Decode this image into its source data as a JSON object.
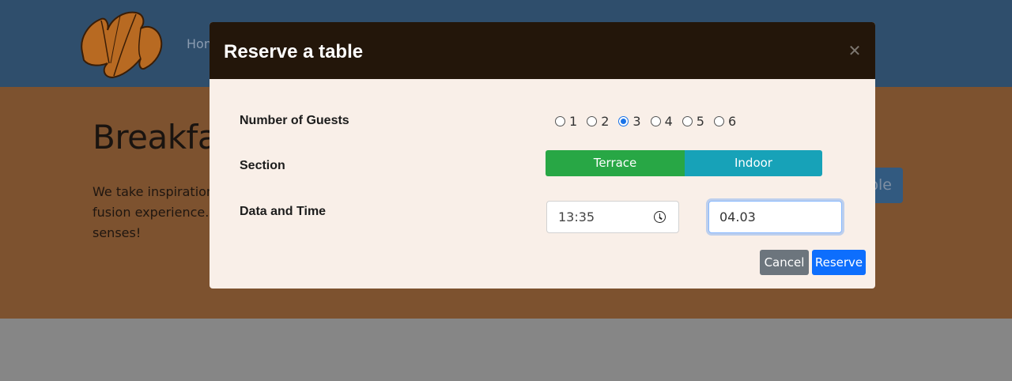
{
  "background": {
    "nav_link": "Hom",
    "hero_title": "Breakfas",
    "hero_text_lines": [
      "We take inspiration",
      "fusion experience. C",
      "senses!"
    ],
    "hero_button_fragment": "ble"
  },
  "modal": {
    "title": "Reserve a table",
    "close_icon": "close-icon",
    "guests_label": "Number of Guests",
    "guest_options": [
      "1",
      "2",
      "3",
      "4",
      "5",
      "6"
    ],
    "guests_selected": "3",
    "section_label": "Section",
    "section_options": [
      "Terrace",
      "Indoor"
    ],
    "datetime_label": "Data and Time",
    "time_value": "13:35",
    "date_value": "04.03",
    "cancel_label": "Cancel",
    "reserve_label": "Reserve"
  },
  "colors": {
    "navbar": "#2f4e6c",
    "hero": "#7d522f",
    "modal_header": "#23160a",
    "modal_body": "#f9efe8",
    "terrace": "#28a745",
    "indoor": "#17a2b8",
    "cancel": "#6c757d",
    "reserve": "#0d6efd"
  }
}
